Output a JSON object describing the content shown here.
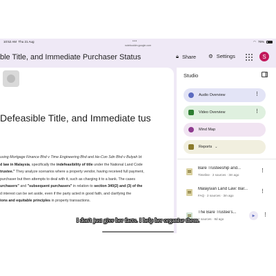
{
  "status_bar": {
    "time": "10:52 AM",
    "date": "Thu 21 Aug",
    "dots": "•••",
    "url": "notebooklm.google.com",
    "battery": "76%"
  },
  "header": {
    "notebook_title": "ble Title, and Immediate Purchaser Status",
    "share_label": "Share",
    "settings_label": "Settings",
    "avatar_letter": "S"
  },
  "source_view": {
    "heading": "Defeasible Title, and Immediate tus",
    "paragraph": {
      "seg1": "using Mortgage Finance Bhd v Time Engineering Bhd",
      "seg2": " and ",
      "seg3": "He-Con Sdn Bhd v Bulyah bt",
      "seg4": "d law in Malaysia",
      "seg5": ", specifically the ",
      "seg6": "indefeasibility of title",
      "seg7": " under the National Land Code",
      "seg8": "trustee.\"",
      "seg9": " They analyze scenarios where a property vendor, having received full payment,",
      "seg10": "purchaser but then attempts to deal with it, such as charging it to a bank. The cases",
      "seg11": "urchasers\"",
      "seg12": " and ",
      "seg13": "\"subsequent purchasers\"",
      "seg14": " in relation to ",
      "seg15": "section 340(2) and (3) of the",
      "seg16": "d interest can be set aside, even if the party acted in good faith, and clarifying the",
      "seg17": "ions and equitable principles",
      "seg18": " in property transactions."
    }
  },
  "studio": {
    "title": "Studio",
    "cards": {
      "audio": "Audio Overview",
      "video": "Video Overview",
      "mind_map": "Mind Map",
      "reports": "Reports"
    },
    "notes": [
      {
        "title": "Bare Trusteeship and...",
        "meta": "Timeline · 2 sources · 3m ago"
      },
      {
        "title": "Malaysian Land Law: Bar...",
        "meta": "FAQ · 2 sources · 3m ago"
      },
      {
        "title": "The Bare Trustee's...",
        "meta": "2 sources · 8d ago"
      }
    ]
  },
  "caption": "I don't just give her facts. I help her organise them."
}
